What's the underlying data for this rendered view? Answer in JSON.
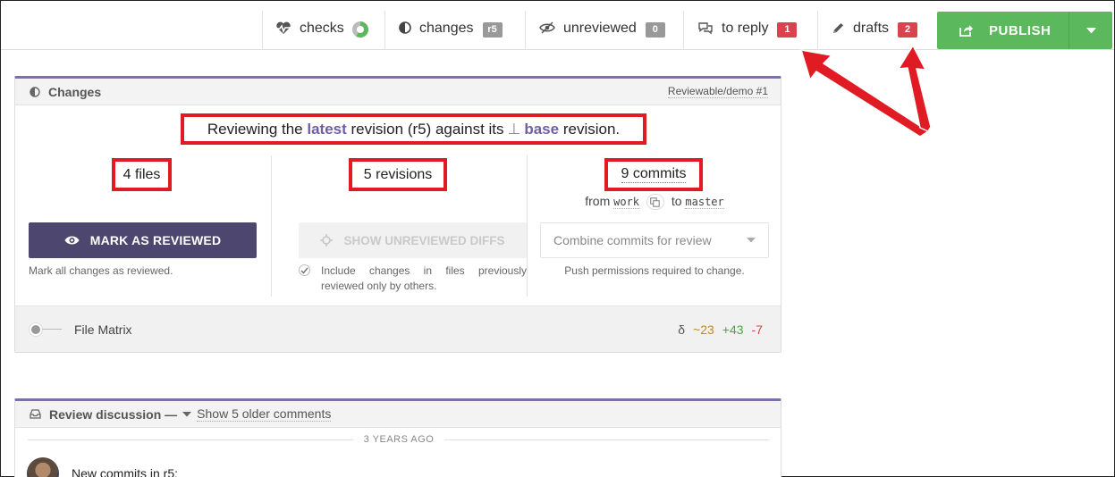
{
  "topbar": {
    "checks": {
      "label": "checks"
    },
    "changes": {
      "label": "changes",
      "badge": "r5"
    },
    "unreviewed": {
      "label": "unreviewed",
      "badge": "0"
    },
    "to_reply": {
      "label": "to reply",
      "badge": "1"
    },
    "drafts": {
      "label": "drafts",
      "badge": "2"
    },
    "publish": {
      "label": "PUBLISH"
    }
  },
  "changes_panel": {
    "title": "Changes",
    "repo_ref": "Reviewable/demo #1",
    "summary": {
      "prefix": "Reviewing the",
      "latest": "latest",
      "middle": "revision (r5) against its",
      "base_symbol": "⊥",
      "base": "base",
      "suffix": "revision."
    },
    "files": {
      "count": "4",
      "unit": "files"
    },
    "revisions": {
      "count": "5",
      "unit": "revisions"
    },
    "commits": {
      "count": "9",
      "unit": "commits",
      "from_label": "from",
      "from_branch": "work",
      "to_label": "to",
      "to_branch": "master"
    },
    "mark_reviewed_button": "MARK AS REVIEWED",
    "mark_reviewed_help": "Mark all changes as reviewed.",
    "show_diffs_button": "SHOW UNREVIEWED DIFFS",
    "show_diffs_help": "Include changes in files previously reviewed only by others.",
    "combine_select": "Combine commits for review",
    "combine_help": "Push permissions required to change.",
    "file_matrix": {
      "label": "File Matrix",
      "delta_symbol": "δ",
      "modified": "~23",
      "added": "+43",
      "removed": "-7"
    }
  },
  "discussion_panel": {
    "title": "Review discussion —",
    "older_link": "Show 5 older comments",
    "time_separator": "3 YEARS AGO",
    "first_comment": "New commits in r5:"
  },
  "colors": {
    "accent_purple": "#7e6fa8",
    "publish_green": "#5cb85c",
    "badge_red": "#d9434e",
    "annotation_red": "#e01b24"
  }
}
